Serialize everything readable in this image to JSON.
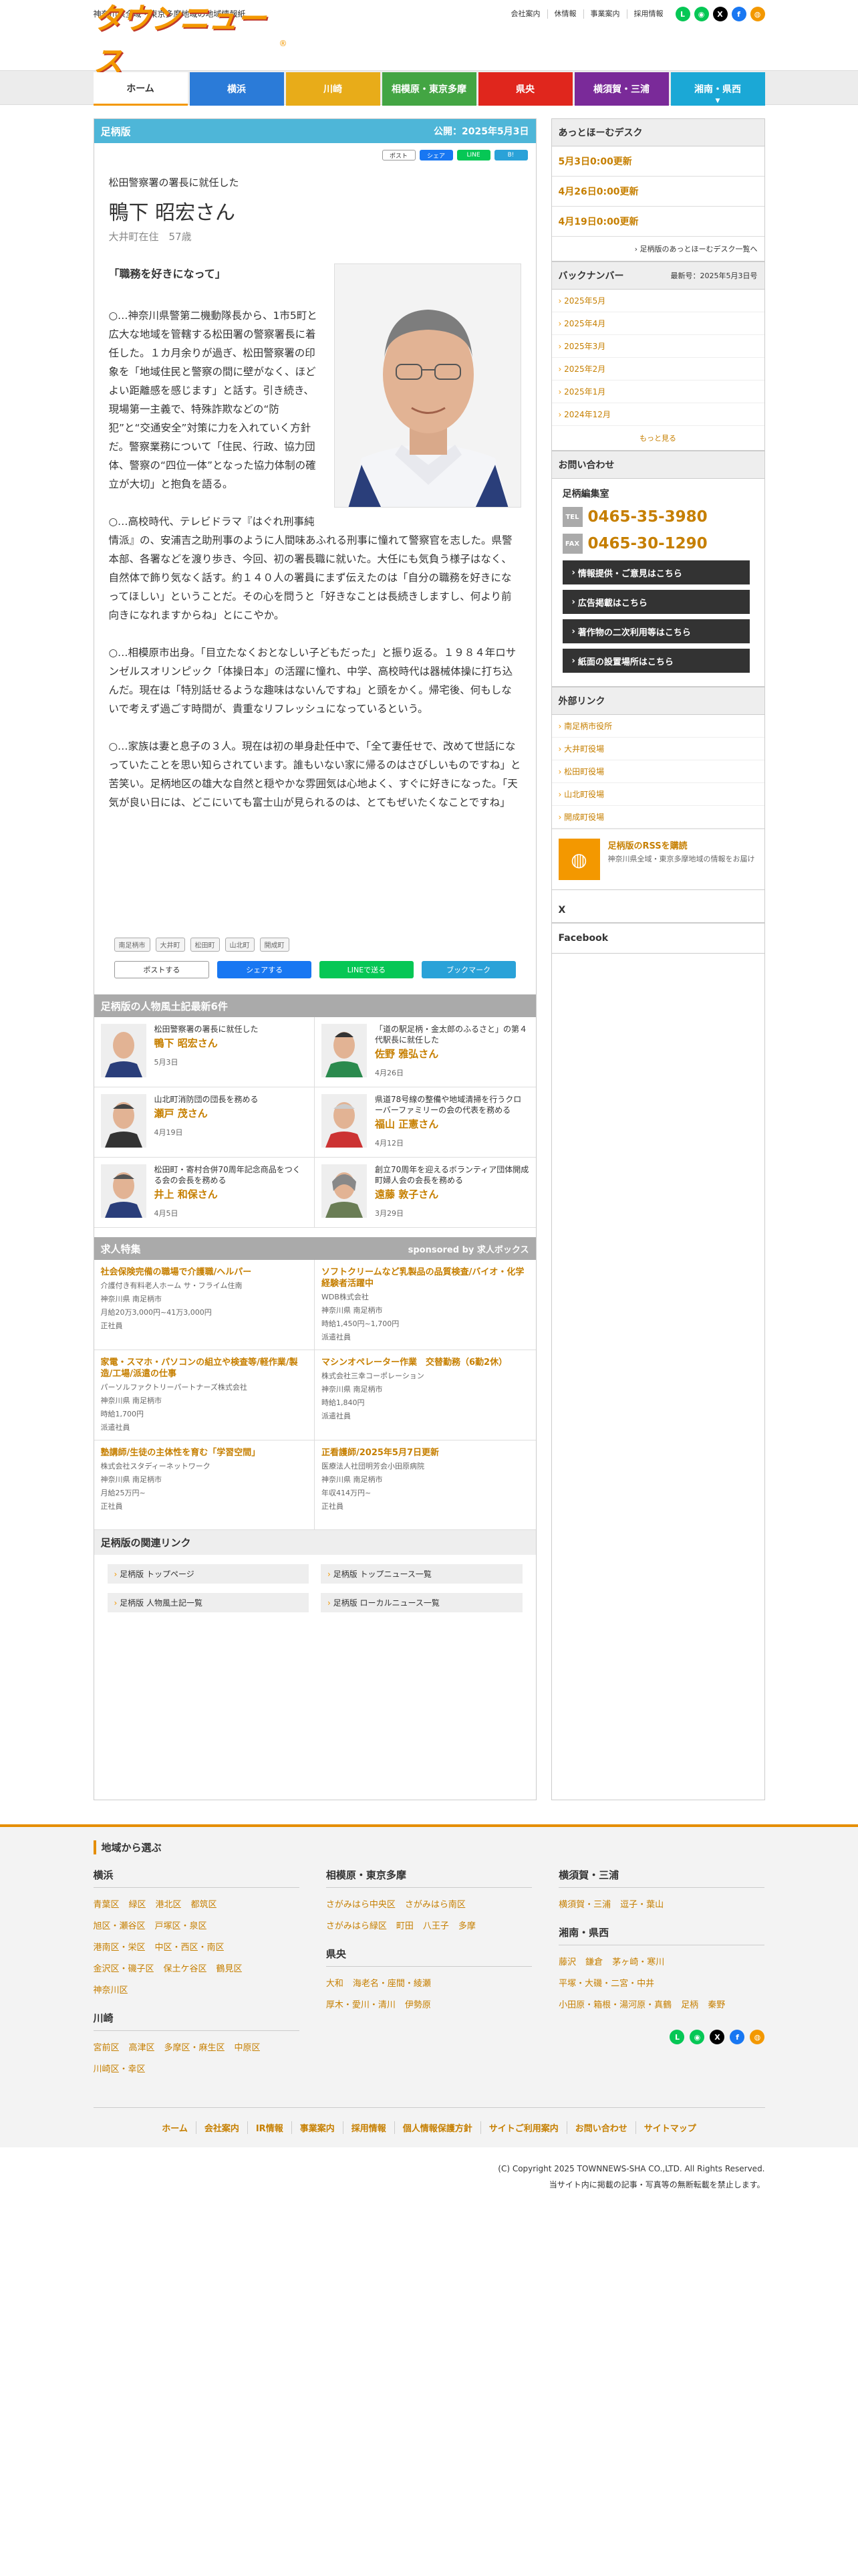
{
  "header": {
    "tagline": "神奈川県全域・東京多摩地域の地域情報紙",
    "logo": "タウンニュース",
    "logo_reg": "®",
    "top_links": [
      "会社案内",
      "休情報",
      "事業案内",
      "採用情報"
    ]
  },
  "nav": [
    {
      "label": "ホーム",
      "color": "#ffffff"
    },
    {
      "label": "横浜",
      "color": "#2b7bd8"
    },
    {
      "label": "川崎",
      "color": "#e8ac19"
    },
    {
      "label": "相模原・東京多摩",
      "color": "#43a543"
    },
    {
      "label": "県央",
      "color": "#e0261d"
    },
    {
      "label": "横須賀・三浦",
      "color": "#7a2a99"
    },
    {
      "label": "湘南・県西",
      "color": "#1ba8d6"
    }
  ],
  "article": {
    "edition": "足柄版",
    "published": "公開：2025年5月3日",
    "lead": "松田警察署の署長に就任した",
    "name": "鴨下 昭宏さん",
    "residence": "大井町在住　57歳",
    "heading": "「職務を好きになって」",
    "paragraphs": [
      "○…神奈川県警第二機動隊長から、1市5町と広大な地域を管轄する松田署の警察署長に着任した。１カ月余りが過ぎ、松田警察署の印象を「地域住民と警察の間に壁がなく、ほどよい距離感を感じます」と話す。引き続き、現場第一主義で、特殊詐欺などの“防犯”と“交通安全”対策に力を入れていく方針だ。警察業務について「住民、行政、協力団体、警察の“四位一体”となった協力体制の確立が大切」と抱負を語る。",
      "○…高校時代、テレビドラマ『はぐれ刑事純情派』の、安浦吉之助刑事のように人間味あふれる刑事に憧れて警察官を志した。県警本部、各署などを渡り歩き、今回、初の署長職に就いた。大任にも気負う様子はなく、自然体で飾り気なく話す。約１４０人の署員にまず伝えたのは「自分の職務を好きになってほしい」ということだ。その心を問うと「好きなことは長続きしますし、何より前向きになれますからね」とにこやか。",
      "○…相模原市出身。「目立たなくおとなしい子どもだった」と振り返る。１９８４年ロサンゼルスオリンピック「体操日本」の活躍に憧れ、中学、高校時代は器械体操に打ち込んだ。現在は「特別話せるような趣味はないんですね」と頭をかく。帰宅後、何もしないで考えず過ごす時間が、貴重なリフレッシュになっているという。",
      "○…家族は妻と息子の３人。現在は初の単身赴任中で、「全て妻任せで、改めて世話になっていたことを思い知らされています。誰もいない家に帰るのはさびしいものですね」と苦笑い。足柄地区の雄大な自然と穏やかな雰囲気は心地よく、すぐに好きになった。「天気が良い日には、どこにいても富士山が見られるのは、とてもぜいたくなことですね」"
    ],
    "tags": [
      "南足柄市",
      "大井町",
      "松田町",
      "山北町",
      "開成町"
    ],
    "share_mini": [
      "ポスト",
      "シェア",
      "LINE",
      "B!"
    ],
    "share_big": [
      "ポストする",
      "シェアする",
      "LINEで送る",
      "ブックマーク"
    ]
  },
  "people": {
    "title": "足柄版の人物風土記最新6件",
    "items": [
      {
        "desc": "松田警察署の署長に就任した",
        "name": "鴨下 昭宏さん",
        "date": "5月3日"
      },
      {
        "desc": "「道の駅足柄・金太郎のふるさと」の第４代駅長に就任した",
        "name": "佐野 雅弘さん",
        "date": "4月26日"
      },
      {
        "desc": "山北町消防団の団長を務める",
        "name": "瀬戸 茂さん",
        "date": "4月19日"
      },
      {
        "desc": "県道78号線の整備や地域清掃を行うクローバーファミリーの会の代表を務める",
        "name": "福山 正憲さん",
        "date": "4月12日"
      },
      {
        "desc": "松田町・寄村合併70周年記念商品をつくる会の会長を務める",
        "name": "井上 和保さん",
        "date": "4月5日"
      },
      {
        "desc": "創立70周年を迎えるボランティア団体開成町婦人会の会長を務める",
        "name": "遠藤 敦子さん",
        "date": "3月29日"
      }
    ]
  },
  "jobs": {
    "title": "求人特集",
    "sponsor": "sponsored by 求人ボックス",
    "items": [
      {
        "title": "社会保険完備の職場で介護職/ヘルパー",
        "company": "介護付き有料老人ホーム サ・フライム住南",
        "place": "神奈川県 南足柄市",
        "pay": "月給20万3,000円~41万3,000円",
        "type": "正社員"
      },
      {
        "title": "ソフトクリームなど乳製品の品質検査/バイオ・化学経験者活躍中",
        "company": "WDB株式会社",
        "place": "神奈川県 南足柄市",
        "pay": "時給1,450円~1,700円",
        "type": "派遣社員"
      },
      {
        "title": "家電・スマホ・パソコンの組立や検査等/軽作業/製造/工場/派遣の仕事",
        "company": "パーソルファクトリーパートナーズ株式会社",
        "place": "神奈川県 南足柄市",
        "pay": "時給1,700円",
        "type": "派遣社員"
      },
      {
        "title": "マシンオペレーター作業　交替勤務（6勤2休）",
        "company": "株式会社三幸コーポレーション",
        "place": "神奈川県 南足柄市",
        "pay": "時給1,840円",
        "type": "派遣社員"
      },
      {
        "title": "塾講師/生徒の主体性を育む「学習空間」",
        "company": "株式会社スタディーネットワーク",
        "place": "神奈川県 南足柄市",
        "pay": "月給25万円~",
        "type": "正社員"
      },
      {
        "title": "正看護師/2025年5月7日更新",
        "company": "医療法人社団明芳会小田原病院",
        "place": "神奈川県 南足柄市",
        "pay": "年収414万円~",
        "type": "正社員"
      }
    ]
  },
  "related": {
    "title": "足柄版の関連リンク",
    "links": [
      "足柄版 トップページ",
      "足柄版 トップニュース一覧",
      "足柄版 人物風土記一覧",
      "足柄版 ローカルニュース一覧"
    ]
  },
  "sidebar": {
    "desk_title": "あっとほーむデスク",
    "desk_items": [
      "5月3日0:00更新",
      "4月26日0:00更新",
      "4月19日0:00更新"
    ],
    "desk_more": "足柄版のあっとほーむデスク一覧へ",
    "back_title": "バックナンバー",
    "back_latest": "最新号：2025年5月3日号",
    "back_items": [
      "2025年5月",
      "2025年4月",
      "2025年3月",
      "2025年2月",
      "2025年1月",
      "2024年12月"
    ],
    "back_more": "もっと見る",
    "contact_title": "お問い合わせ",
    "contact_office": "足柄編集室",
    "tel_label": "TEL",
    "tel": "0465-35-3980",
    "fax_label": "FAX",
    "fax": "0465-30-1290",
    "buttons": [
      "情報提供・ご意見はこちら",
      "広告掲載はこちら",
      "著作物の二次利用等はこちら",
      "紙面の設置場所はこちら"
    ],
    "ext_title": "外部リンク",
    "ext_links": [
      "南足柄市役所",
      "大井町役場",
      "松田町役場",
      "山北町役場",
      "開成町役場"
    ],
    "rss_title": "足柄版のRSSを購読",
    "rss_sub": "神奈川県全域・東京多摩地域の情報をお届け",
    "x_title": "X",
    "fb_title": "Facebook"
  },
  "footer": {
    "heading": "地域から選ぶ",
    "regions": [
      {
        "name": "横浜",
        "rows": [
          [
            "青葉区",
            "緑区",
            "港北区",
            "都筑区"
          ],
          [
            "旭区・瀬谷区",
            "戸塚区・泉区"
          ],
          [
            "港南区・栄区",
            "中区・西区・南区"
          ],
          [
            "金沢区・磯子区",
            "保土ケ谷区",
            "鶴見区"
          ],
          [
            "神奈川区"
          ]
        ]
      },
      {
        "name": "川崎",
        "rows": [
          [
            "宮前区",
            "高津区",
            "多摩区・麻生区",
            "中原区"
          ],
          [
            "川崎区・幸区"
          ]
        ]
      },
      {
        "name": "相模原・東京多摩",
        "rows": [
          [
            "さがみはら中央区",
            "さがみはら南区"
          ],
          [
            "さがみはら緑区",
            "町田",
            "八王子",
            "多摩"
          ]
        ]
      },
      {
        "name": "県央",
        "rows": [
          [
            "大和",
            "海老名・座間・綾瀬"
          ],
          [
            "厚木・愛川・清川",
            "伊勢原"
          ]
        ]
      },
      {
        "name": "横須賀・三浦",
        "rows": [
          [
            "横須賀・三浦",
            "逗子・葉山"
          ]
        ]
      },
      {
        "name": "湘南・県西",
        "rows": [
          [
            "藤沢",
            "鎌倉",
            "茅ヶ崎・寒川"
          ],
          [
            "平塚・大磯・二宮・中井"
          ],
          [
            "小田原・箱根・湯河原・真鶴",
            "足柄",
            "秦野"
          ]
        ]
      }
    ],
    "links": [
      "ホーム",
      "会社案内",
      "IR情報",
      "事業案内",
      "採用情報",
      "個人情報保護方針",
      "サイトご利用案内",
      "お問い合わせ",
      "サイトマップ"
    ],
    "copyright": "(C) Copyright 2025 TOWNNEWS-SHA CO.,LTD. All Rights Reserved.",
    "notice": "当サイト内に掲載の記事・写真等の無断転載を禁止します。"
  }
}
